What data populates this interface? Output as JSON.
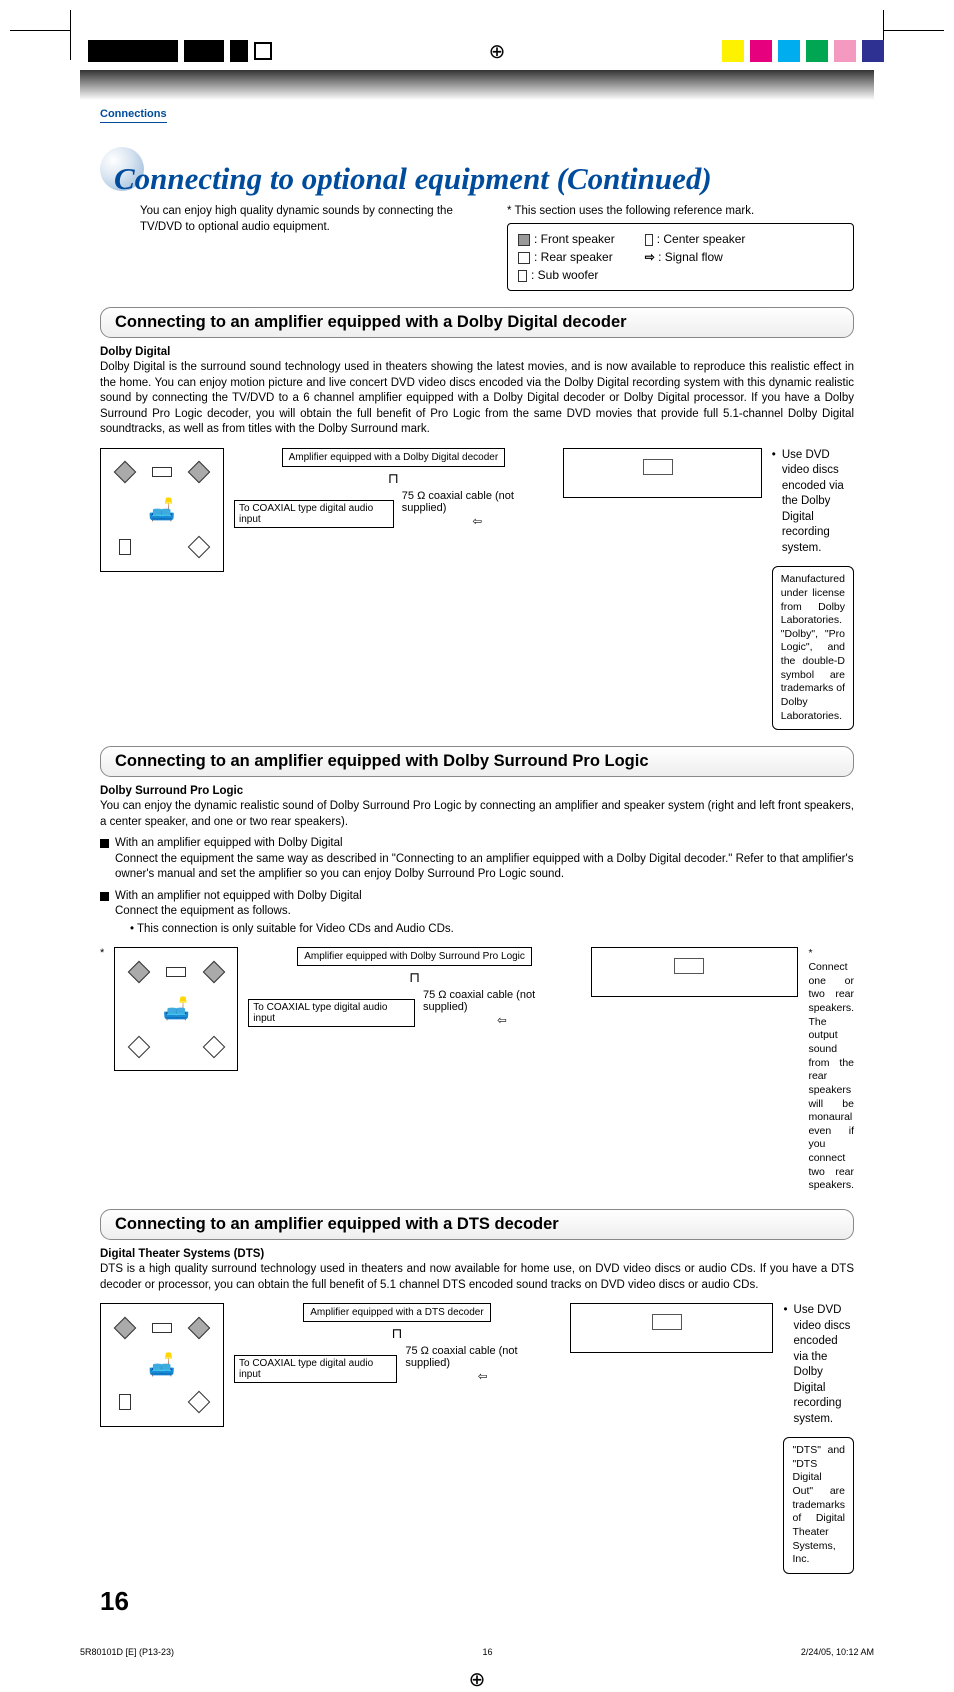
{
  "header": {
    "section_label": "Connections",
    "main_title": "Connecting to optional equipment (Continued)",
    "intro_left": "You can enjoy high quality dynamic sounds by connecting the TV/DVD to optional audio equipment.",
    "intro_right_note": "* This section uses the following reference mark."
  },
  "legend": {
    "front": ": Front speaker",
    "rear": ": Rear speaker",
    "sub": ": Sub woofer",
    "center": ": Center speaker",
    "signal": ": Signal flow"
  },
  "sec1": {
    "heading": "Connecting to an amplifier equipped with a Dolby Digital decoder",
    "bold": "Dolby Digital",
    "body": "Dolby Digital is the surround sound technology used in theaters showing the latest movies, and is now available to reproduce this realistic effect in the home. You can enjoy motion picture and live concert DVD video discs encoded via the Dolby Digital recording system with this dynamic realistic sound by connecting the TV/DVD to a 6 channel amplifier equipped with a Dolby Digital decoder or Dolby Digital processor. If you have a Dolby Surround Pro Logic decoder, you will obtain the full benefit of Pro Logic from the same DVD movies that provide full 5.1-channel Dolby Digital soundtracks, as well as from titles with the Dolby Surround mark.",
    "amp_label": "Amplifier equipped with a Dolby Digital decoder",
    "coax_label": "To COAXIAL type digital audio input",
    "cable_label": "75 Ω coaxial cable (not supplied)",
    "right_bullet": "Use DVD video discs encoded via the Dolby Digital recording system.",
    "license": "Manufactured under license from Dolby Laboratories. \"Dolby\", \"Pro Logic\", and the double-D symbol are trademarks of Dolby Laboratories."
  },
  "sec2": {
    "heading": "Connecting to an amplifier equipped with Dolby Surround Pro Logic",
    "bold": "Dolby Surround Pro Logic",
    "body": "You can enjoy the dynamic realistic sound of Dolby Surround Pro Logic by connecting an amplifier and speaker system (right and left front speakers, a center speaker, and one or two rear speakers).",
    "b1_title": "With an amplifier equipped with Dolby Digital",
    "b1_body": "Connect the equipment the same way as described in \"Connecting to an amplifier equipped with a Dolby Digital decoder.\" Refer to that amplifier's owner's manual and set the amplifier so you can enjoy Dolby Surround Pro Logic sound.",
    "b2_title": "With an amplifier not equipped with Dolby Digital",
    "b2_body": "Connect the equipment as follows.",
    "b2_note": "• This connection is only suitable for Video CDs and Audio CDs.",
    "amp_label": "Amplifier equipped with Dolby Surround Pro Logic",
    "coax_label": "To COAXIAL type digital audio input",
    "cable_label": "75 Ω coaxial cable (not supplied)",
    "asterisk_note": "* Connect one or two rear speakers. The output sound from the rear speakers will be monaural even if you connect two rear speakers."
  },
  "sec3": {
    "heading": "Connecting to an amplifier equipped with a DTS decoder",
    "bold": "Digital Theater Systems (DTS)",
    "body": "DTS is a high quality surround technology used in theaters and now available for home use, on DVD video discs or audio CDs. If you have a DTS decoder or processor, you can obtain the full benefit of 5.1 channel DTS encoded sound tracks on DVD video discs or audio CDs.",
    "amp_label": "Amplifier equipped with a DTS decoder",
    "coax_label": "To COAXIAL type digital audio input",
    "cable_label": "75 Ω coaxial cable (not supplied)",
    "right_bullet": "Use DVD video discs encoded via the Dolby Digital recording system.",
    "license": "\"DTS\" and \"DTS Digital Out\" are trademarks of Digital Theater Systems, Inc."
  },
  "page_number": "16",
  "footer": {
    "left": "5R80101D [E] (P13-23)",
    "center": "16",
    "right": "2/24/05, 10:12 AM"
  }
}
